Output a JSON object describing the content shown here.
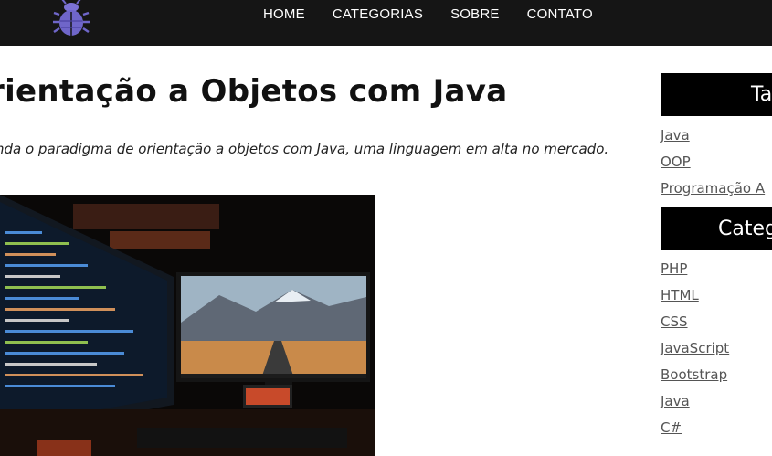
{
  "nav": {
    "items": [
      "HOME",
      "CATEGORIAS",
      "SOBRE",
      "CONTATO"
    ]
  },
  "article": {
    "title": "rientação a Objetos com Java",
    "subtitle": "nda o paradigma de orientação a objetos com Java, uma linguagem em alta no mercado."
  },
  "sidebar": {
    "tags_heading": "Ta",
    "tags": [
      "Java",
      "OOP",
      "Programação A"
    ],
    "categories_heading": "Categ",
    "categories": [
      "PHP",
      "HTML",
      "CSS",
      "JavaScript",
      "Bootstrap",
      "Java",
      "C#"
    ]
  },
  "colors": {
    "header_bg": "#151515",
    "logo": "#6f66c9",
    "sidebar_heading_bg": "#000000",
    "link": "#555555"
  },
  "icons": {
    "logo": "bug-icon"
  }
}
